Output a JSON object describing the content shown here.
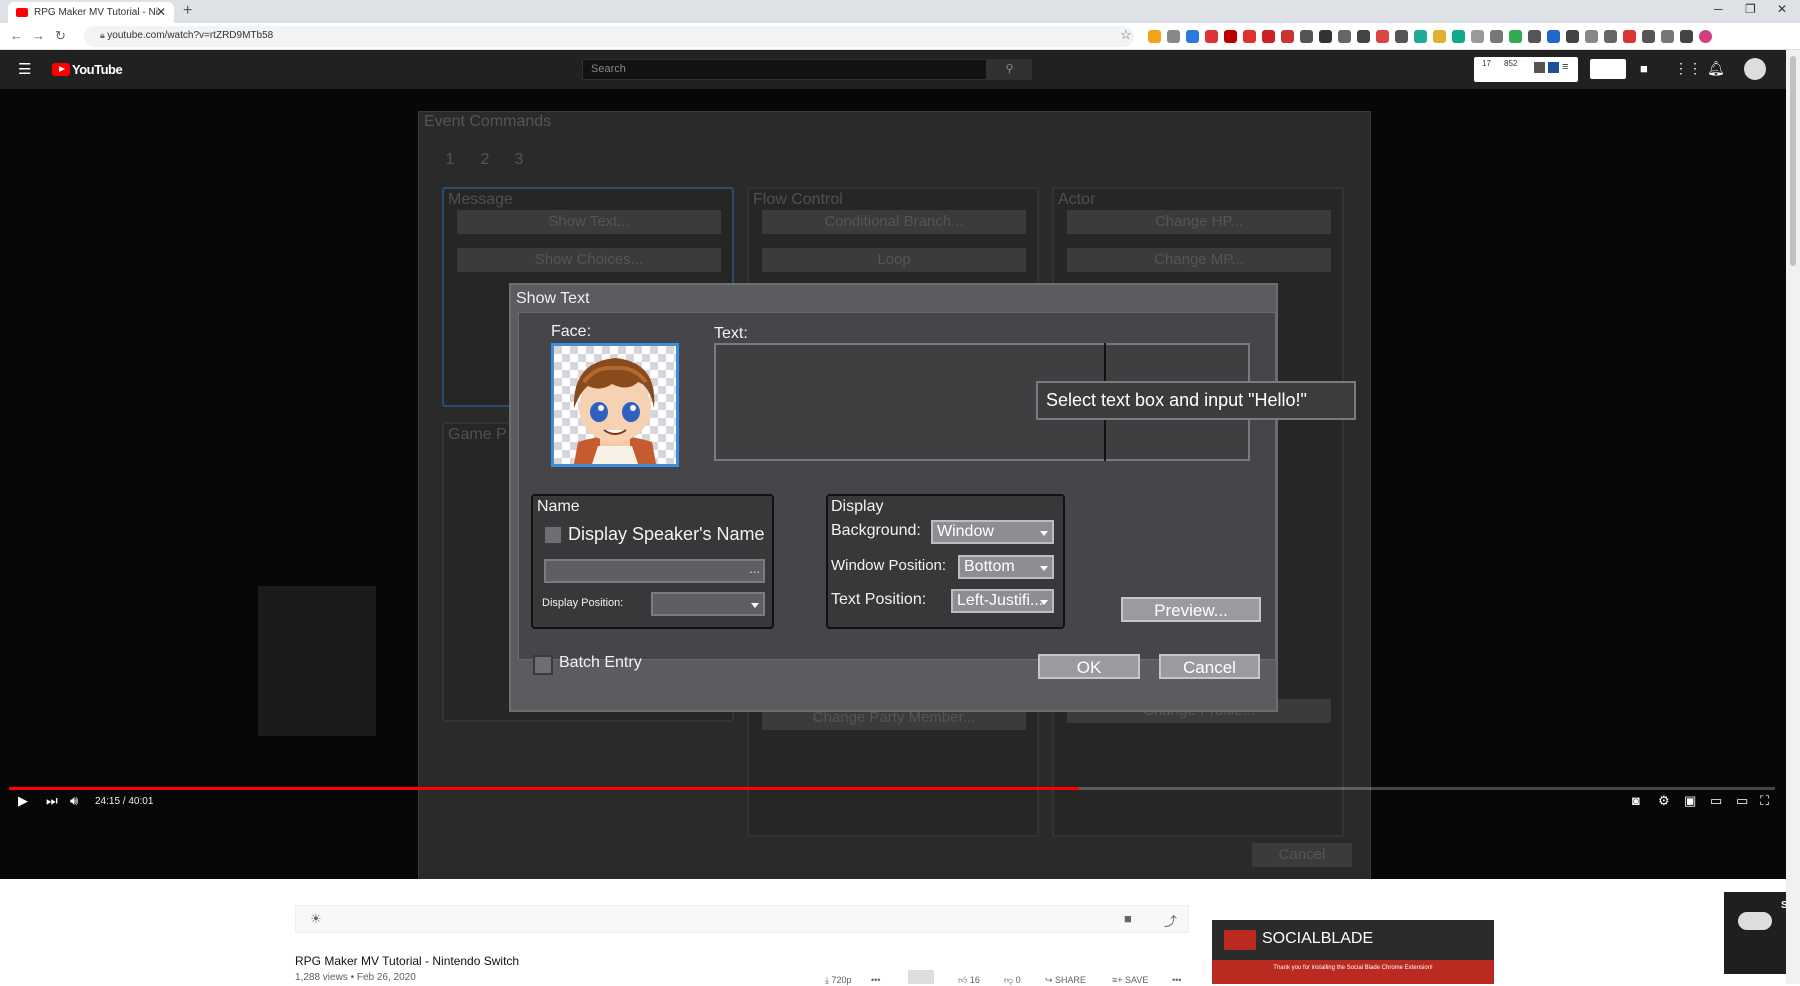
{
  "browser": {
    "tab_title": "RPG Maker MV Tutorial - Ni",
    "tab_close": "✕",
    "new_tab": "+",
    "url": "youtube.com/watch?v=rtZRD9MTb58",
    "win_min": "─",
    "win_max": "❐",
    "win_close": "✕"
  },
  "youtube": {
    "brand": "YouTube",
    "search_placeholder": "Search",
    "stat_a": "17",
    "stat_b": "852"
  },
  "editor_bg": {
    "title": "Event Commands",
    "tabs": [
      "1",
      "2",
      "3"
    ],
    "groups": {
      "message": "Message",
      "flow": "Flow Control",
      "actor": "Actor",
      "game": "Game P"
    },
    "buttons": {
      "show_text": "Show Text...",
      "show_choices": "Show Choices...",
      "conditional_branch": "Conditional Branch...",
      "loop": "Loop",
      "change_hp": "Change HP...",
      "change_mp": "Change MP...",
      "change_party_member": "Change Party Member...",
      "change_profile": "Change Profile...",
      "cancel": "Cancel"
    }
  },
  "dialog": {
    "title": "Show Text",
    "face_label": "Face:",
    "text_label": "Text:",
    "tooltip": "Select text box and input \"Hello!\"",
    "name_panel": {
      "title": "Name",
      "display_speaker_label": "Display Speaker's Name",
      "name_field_button": "...",
      "display_position_label": "Display Position:"
    },
    "display_panel": {
      "title": "Display",
      "background_label": "Background:",
      "background_value": "Window",
      "window_position_label": "Window Position:",
      "window_position_value": "Bottom",
      "text_position_label": "Text Position:",
      "text_position_value": "Left-Justifi..."
    },
    "preview_button": "Preview...",
    "batch_entry_label": "Batch Entry",
    "ok_button": "OK",
    "cancel_button": "Cancel"
  },
  "player": {
    "time": "24:15 / 40:01",
    "progress_fraction": 0.606,
    "buffered_fraction": 0.541
  },
  "video_info": {
    "title": "RPG Maker MV Tutorial - Nintendo Switch",
    "meta": "1,288 views • Feb 26, 2020",
    "quality": "720p",
    "likes": "16",
    "dislikes": "0",
    "share": "SHARE",
    "save": "SAVE"
  },
  "socialblade": {
    "name": "SOCIALBLADE",
    "note": "Thank you for installing the Social Blade Chrome Extension!"
  },
  "onedrive": {
    "title": "Scre"
  }
}
